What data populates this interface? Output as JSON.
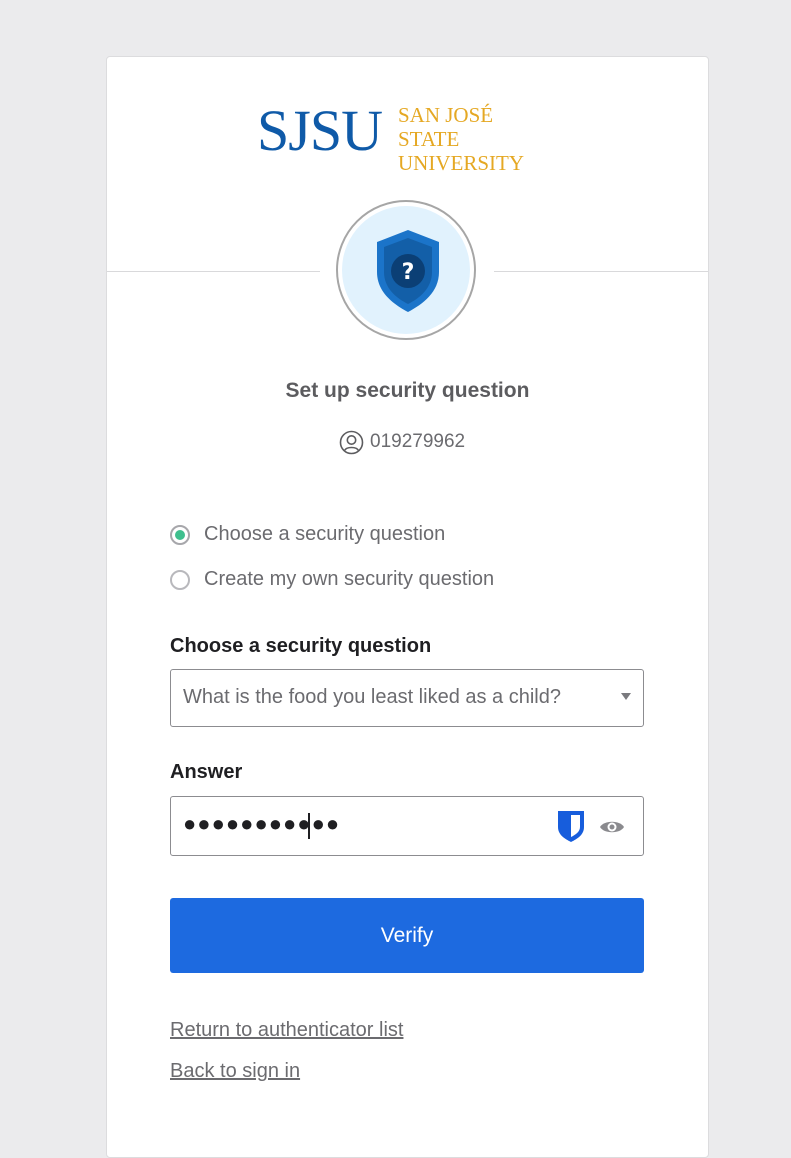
{
  "brand": {
    "logo_mark": "SJSU",
    "logo_line1": "SAN JOSÉ STATE",
    "logo_line2": "UNIVERSITY",
    "primary_color": "#0f5aa8",
    "gold_color": "#e5a823"
  },
  "header": {
    "icon": "shield-question-icon",
    "title": "Set up security question",
    "user_icon": "user-circle-icon",
    "user_id": "019279962"
  },
  "question_mode": {
    "options": [
      {
        "label": "Choose a security question",
        "selected": true
      },
      {
        "label": "Create my own security question",
        "selected": false
      }
    ]
  },
  "question_select": {
    "label": "Choose a security question",
    "value": "What is the food you least liked as a child?"
  },
  "answer": {
    "label": "Answer",
    "masked_value": "●●●●●●●●●●●",
    "password_manager_icon": "bitwarden-shield-icon",
    "reveal_icon": "eye-icon"
  },
  "actions": {
    "verify_label": "Verify",
    "verify_color": "#1d6ae0",
    "return_link": "Return to authenticator list",
    "back_link": "Back to sign in"
  }
}
